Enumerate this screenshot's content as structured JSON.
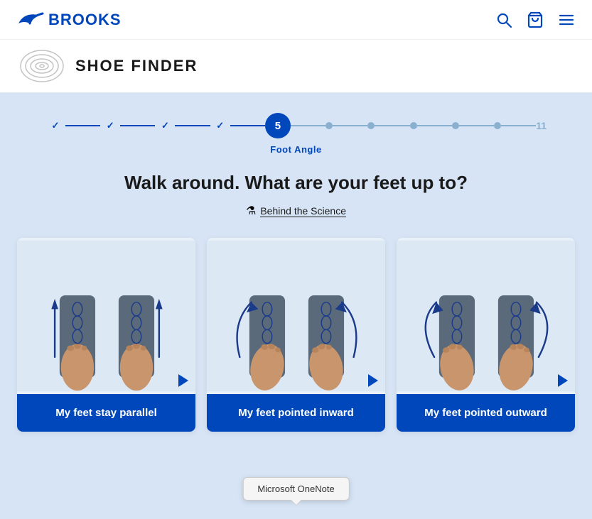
{
  "header": {
    "logo_text": "BROOKS",
    "search_label": "Search",
    "bag_label": "Shopping Bag",
    "menu_label": "Menu"
  },
  "shoe_finder": {
    "title": "SHOE FINDER"
  },
  "progress": {
    "steps_done": [
      1,
      2,
      3,
      4
    ],
    "active_step": 5,
    "active_label": "Foot Angle",
    "remaining_dots": [
      6,
      7,
      8,
      9,
      10
    ],
    "last_step": 11
  },
  "question": {
    "title": "Walk around. What are your feet up to?",
    "science_link": "Behind the Science"
  },
  "options": [
    {
      "id": "parallel",
      "label": "My feet stay parallel",
      "arrow_type": "straight"
    },
    {
      "id": "inward",
      "label": "My feet pointed inward",
      "arrow_type": "inward"
    },
    {
      "id": "outward",
      "label": "My feet pointed outward",
      "arrow_type": "outward"
    }
  ],
  "tooltip": {
    "text": "Microsoft OneNote"
  }
}
